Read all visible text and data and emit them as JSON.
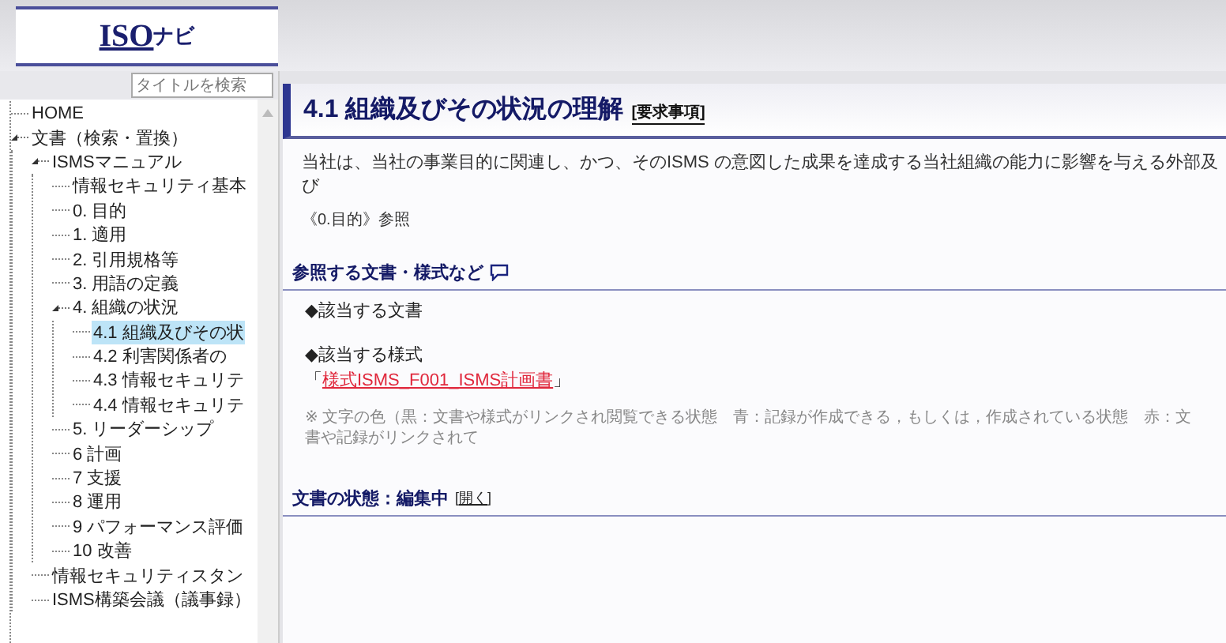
{
  "logo": {
    "text_main": "ISO",
    "text_sub": "ナビ"
  },
  "sidebar": {
    "search": {
      "placeholder": "タイトルを検索"
    },
    "tree": [
      {
        "label": "HOME",
        "expanded": false,
        "selected": false
      },
      {
        "label": "文書（検索・置換）",
        "expanded": true,
        "selected": false,
        "children": [
          {
            "label": "ISMSマニュアル",
            "expanded": true,
            "selected": false,
            "children": [
              {
                "label": "情報セキュリティ基本",
                "expanded": false,
                "selected": false
              },
              {
                "label": "0. 目的",
                "expanded": false,
                "selected": false
              },
              {
                "label": "1. 適用",
                "expanded": false,
                "selected": false
              },
              {
                "label": "2. 引用規格等",
                "expanded": false,
                "selected": false
              },
              {
                "label": "3. 用語の定義",
                "expanded": false,
                "selected": false
              },
              {
                "label": "4. 組織の状況",
                "expanded": true,
                "selected": false,
                "children": [
                  {
                    "label": "4.1 組織及びその状",
                    "expanded": false,
                    "selected": true
                  },
                  {
                    "label": "4.2 利害関係者の",
                    "expanded": false,
                    "selected": false
                  },
                  {
                    "label": "4.3 情報セキュリテ",
                    "expanded": false,
                    "selected": false
                  },
                  {
                    "label": "4.4 情報セキュリテ",
                    "expanded": false,
                    "selected": false
                  }
                ]
              },
              {
                "label": "5. リーダーシップ",
                "expanded": false,
                "selected": false
              },
              {
                "label": "6 計画",
                "expanded": false,
                "selected": false
              },
              {
                "label": "7 支援",
                "expanded": false,
                "selected": false
              },
              {
                "label": "8 運用",
                "expanded": false,
                "selected": false
              },
              {
                "label": "9 パフォーマンス評価",
                "expanded": false,
                "selected": false
              },
              {
                "label": "10 改善",
                "expanded": false,
                "selected": false
              }
            ]
          },
          {
            "label": "情報セキュリティスタン",
            "expanded": false,
            "selected": false
          },
          {
            "label": "ISMS構築会議（議事録）",
            "expanded": false,
            "selected": false
          }
        ]
      }
    ]
  },
  "page": {
    "title": "4.1 組織及びその状況の理解",
    "title_tag": "[要求事項]",
    "body": "当社は、当社の事業目的に関連し、かつ、そのISMS の意図した成果を達成する当社組織の能力に影響を与える外部及び",
    "reference": "《0.目的》参照",
    "ref_heading": "参照する文書・様式など",
    "doc_heading": "◆該当する文書",
    "form_heading": "◆該当する様式",
    "form_link_open": "「",
    "form_link": "様式ISMS_F001_ISMS計画書",
    "form_link_close": "」",
    "note": "※ 文字の色（黒：文書や様式がリンクされ閲覧できる状態　青：記録が作成できる，もしくは，作成されている状態　赤：文書や記録がリンクされて",
    "status_label": "文書の状態：編集中",
    "status_link": "[開く]"
  }
}
